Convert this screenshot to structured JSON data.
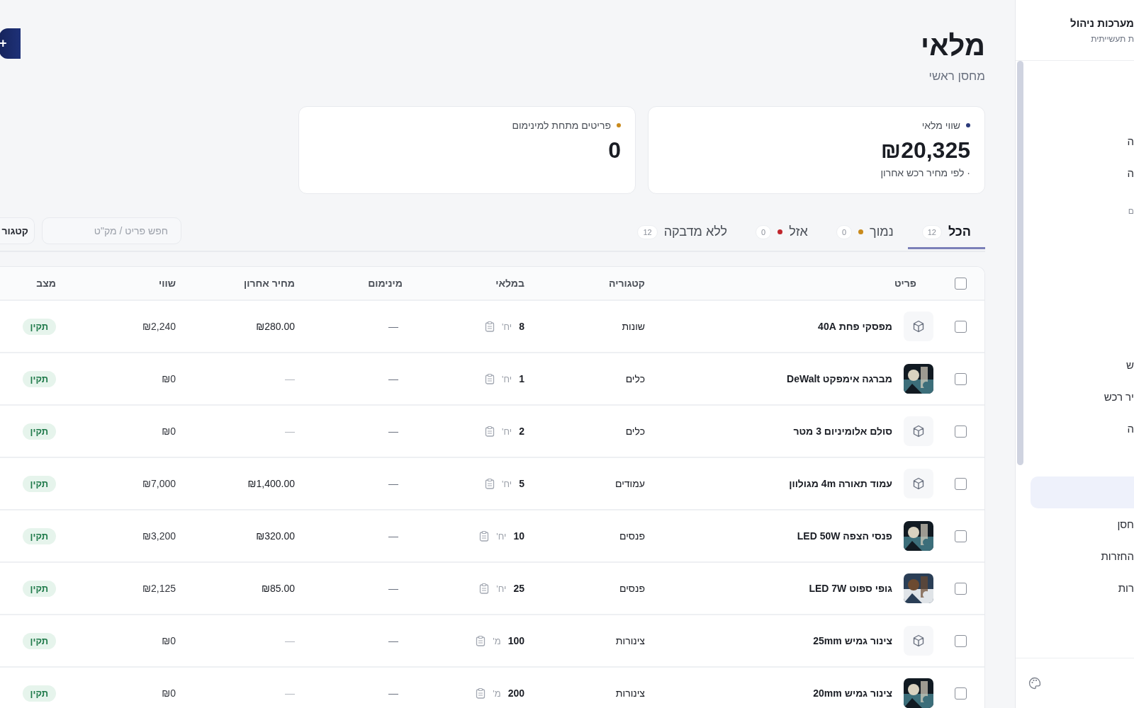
{
  "sidebar": {
    "title": "מערכות ניהול",
    "subtitle": "ת תעשייתית",
    "groups": [
      {
        "items": [
          {
            "label": "ה",
            "selected": false
          },
          {
            "label": "ה",
            "selected": false
          }
        ]
      },
      {
        "title": "ם",
        "items": [
          {
            "label": "ש",
            "selected": false
          },
          {
            "label": "יר רכש",
            "selected": false
          },
          {
            "label": "ה",
            "selected": false
          }
        ]
      },
      {
        "items": [
          {
            "selected": true
          },
          {
            "label": "חסן",
            "selected": false
          },
          {
            "label": "החזרות",
            "selected": false
          },
          {
            "label": "רות",
            "selected": false
          }
        ]
      }
    ]
  },
  "header": {
    "title": "מלאי",
    "subtitle": "מחסן ראשי",
    "add_button": "+"
  },
  "stats": [
    {
      "label": "שווי מלאי",
      "color": "#2b3a7a",
      "value": "₪20,325",
      "note": "· לפי מחיר רכש אחרון"
    },
    {
      "label": "פריטים מתחת למינימום",
      "color": "#c98a1c",
      "value": "0"
    }
  ],
  "tabs": [
    {
      "label": "הכל",
      "count": "12",
      "selected": true
    },
    {
      "label": "נמוך",
      "count": "0",
      "color": "#c98a1c",
      "selected": false
    },
    {
      "label": "אזל",
      "count": "0",
      "color": "#c0262d",
      "selected": false
    },
    {
      "label": "ללא מדבקה",
      "count": "12",
      "selected": false
    }
  ],
  "search": {
    "placeholder": "חפש פריט / מק\"ט"
  },
  "category_button": "קטגור",
  "table": {
    "select_all": {
      "checked": false
    },
    "columns": [
      "פריט",
      "קטגוריה",
      "במלאי",
      "מינימום",
      "מחיר אחרון",
      "שווי",
      "מצב"
    ],
    "rows": [
      {
        "checked": false,
        "thumbnail": {
          "kind": "box"
        },
        "name": "מפסקי פחת 40A",
        "category": "שונות",
        "qty": "8",
        "unit": "יח'",
        "minimum": "—",
        "last_price": "₪280.00",
        "value": "₪2,240",
        "status": {
          "label": "תקין",
          "kind": "ok"
        }
      },
      {
        "checked": false,
        "name": "מברגה אימפקט DeWalt",
        "category": "כלים",
        "qty": "1",
        "unit": "יח'",
        "minimum": "—",
        "last_price": "—",
        "value": "₪0",
        "status": {
          "label": "תקין",
          "kind": "ok"
        }
      },
      {
        "checked": false,
        "thumbnail": {
          "kind": "box"
        },
        "name": "סולם אלומיניום 3 מטר",
        "category": "כלים",
        "qty": "2",
        "unit": "יח'",
        "minimum": "—",
        "last_price": "—",
        "value": "₪0",
        "status": {
          "label": "תקין",
          "kind": "ok"
        }
      },
      {
        "checked": false,
        "thumbnail": {
          "kind": "box"
        },
        "name": "עמוד תאורה 4m מגולוון",
        "category": "עמודים",
        "qty": "5",
        "unit": "יח'",
        "minimum": "—",
        "last_price": "₪1,400.00",
        "value": "₪7,000",
        "status": {
          "label": "תקין",
          "kind": "ok"
        }
      },
      {
        "checked": false,
        "name": "פנסי הצפה LED 50W",
        "category": "פנסים",
        "qty": "10",
        "unit": "יח'",
        "minimum": "—",
        "last_price": "₪320.00",
        "value": "₪3,200",
        "status": {
          "label": "תקין",
          "kind": "ok"
        }
      },
      {
        "checked": false,
        "name": "גופי ספוט LED 7W",
        "category": "פנסים",
        "qty": "25",
        "unit": "יח'",
        "minimum": "—",
        "last_price": "₪85.00",
        "value": "₪2,125",
        "status": {
          "label": "תקין",
          "kind": "ok"
        }
      },
      {
        "checked": false,
        "thumbnail": {
          "kind": "box"
        },
        "name": "צינור גמיש 25mm",
        "category": "צינורות",
        "qty": "100",
        "unit": "מ'",
        "minimum": "—",
        "last_price": "—",
        "value": "₪0",
        "status": {
          "label": "תקין",
          "kind": "ok"
        }
      },
      {
        "checked": false,
        "name": "צינור גמיש 20mm",
        "category": "צינורות",
        "qty": "200",
        "unit": "מ'",
        "minimum": "—",
        "last_price": "—",
        "value": "₪0",
        "status": {
          "label": "תקין",
          "kind": "ok"
        }
      }
    ]
  }
}
